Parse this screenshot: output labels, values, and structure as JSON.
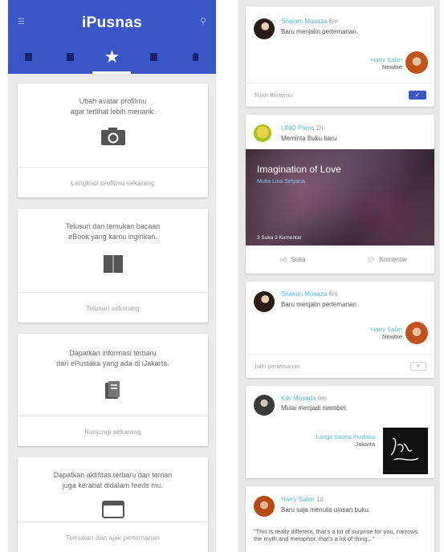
{
  "left": {
    "app_title": "iPusnas",
    "tabs": [
      {
        "icon": "grid-icon",
        "active": false
      },
      {
        "icon": "bookmark-icon",
        "active": false
      },
      {
        "icon": "star-icon",
        "active": true
      },
      {
        "icon": "bag-icon",
        "active": false
      },
      {
        "icon": "bell-icon",
        "active": false
      }
    ],
    "cards": [
      {
        "text": "Ubah avatar profilmu\nagar terlihat lebih menarik.",
        "icon": "camera-icon",
        "action": "Lengkapi profilmu sekarang"
      },
      {
        "text": "Telusuri dan temukan bacaan\neBook yang kamu inginkan.",
        "icon": "open-book-icon",
        "action": "Telusuri sekarang"
      },
      {
        "text": "Dapatkan informasi terbaru\ndari ePustaka yang ada di iJakarta.",
        "icon": "library-icon",
        "action": "Kunjungi sekarang"
      },
      {
        "text": "Dapatkan aktifitas terbaru dari teman\njuga kerabat didalam feeds mu.",
        "icon": "browser-window-icon",
        "action": "Temukan dan ajak pertemanan"
      }
    ]
  },
  "right": {
    "feed": [
      {
        "user": "Shalom Mosaza",
        "time": "6m",
        "action": "Baru menjalin pertemanan.",
        "friend_name": "Harry Salim",
        "friend_status": "Newbie",
        "footer": "Telah Bertemu",
        "button": "✓"
      },
      {
        "user": "LINO Press",
        "time": "1h",
        "action": "Meminta Buku baru",
        "book_title": "Imagination of Love",
        "book_author": "Mutia Lina Setyana",
        "book_meta": "3 Suka  3 Komentar",
        "like_label": "Suka",
        "comment_label": "Komentar"
      },
      {
        "user": "Shalom Mosaza",
        "time": "6m",
        "action": "Baru menjalin pertemanan.",
        "friend_name": "Harry Salim",
        "friend_status": "Newbie",
        "footer": "Jalin pertemanan",
        "button": "+"
      },
      {
        "user": "Kiki Mosada",
        "time": "6m",
        "action": "Mulai menjadi member.",
        "library_name": "Langit Sastra Pustaka",
        "library_city": "Jakarta"
      },
      {
        "user": "Harry Salim",
        "time": "1d",
        "action": "Baru saja menulis ulasan buku.",
        "quote": "\"This is really different, that's a lot of surprise for you, narrows the myth and metaphor. that's a lot of thing...\""
      }
    ]
  },
  "colors": {
    "primary": "#3b56c6",
    "link": "#57b7e0"
  }
}
